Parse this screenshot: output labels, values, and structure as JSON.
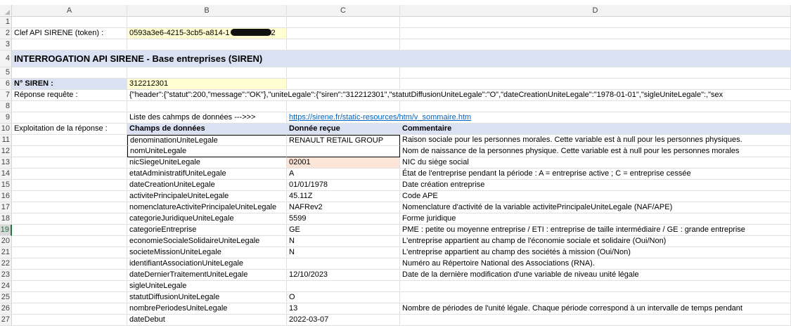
{
  "columns": [
    "A",
    "B",
    "C",
    "D"
  ],
  "rows": [
    {
      "n": "1"
    },
    {
      "n": "2",
      "a": "Clef API SIRENE (token) :",
      "b": "0593a3e6-4215-3cb5-a814-1",
      "b_tail": "2"
    },
    {
      "n": "3"
    },
    {
      "n": "4",
      "a": "INTERROGATION API SIRENE - Base entreprises (SIREN)"
    },
    {
      "n": "5"
    },
    {
      "n": "6",
      "a": "N° SIREN :",
      "b": "312212301"
    },
    {
      "n": "7",
      "a": "Réponse requête :",
      "b": "{\"header\":{\"statut\":200,\"message\":\"OK\"},\"uniteLegale\":{\"siren\":\"312212301\",\"statutDiffusionUniteLegale\":\"O\",\"dateCreationUniteLegale\":\"1978-01-01\",\"sigleUniteLegale\":,\"sex"
    },
    {
      "n": "8"
    },
    {
      "n": "9",
      "b": "Liste des cahmps de données --->>>",
      "c": "https://sirene.fr/static-resources/htm/v_sommaire.htm"
    },
    {
      "n": "10",
      "a": "Exploitation de la réponse :",
      "b": "Champs de données",
      "c": "Donnée reçue",
      "d": "Commentaire"
    },
    {
      "n": "11",
      "b": "denominationUniteLegale",
      "c": "RENAULT RETAIL GROUP",
      "d": "Raison sociale pour les personnes morales. Cette variable est à null pour les personnes physiques."
    },
    {
      "n": "12",
      "b": "nomUniteLegale",
      "c": "",
      "d": "Nom de naissance de la personnes physique. Cette variable est à null pour les personnes morales"
    },
    {
      "n": "13",
      "b": "nicSiegeUniteLegale",
      "c": "02001",
      "d": "NIC du siège social"
    },
    {
      "n": "14",
      "b": "etatAdministratifUniteLegale",
      "c": "A",
      "d": "État de l'entreprise pendant la période : A = entreprise active ; C = entreprise cessée"
    },
    {
      "n": "15",
      "b": "dateCreationUniteLegale",
      "c": "01/01/1978",
      "d": "Date création entreprise"
    },
    {
      "n": "16",
      "b": "activitePrincipaleUniteLegale",
      "c": "45.11Z",
      "d": "Code APE"
    },
    {
      "n": "17",
      "b": "nomenclatureActivitePrincipaleUniteLegale",
      "c": "NAFRev2",
      "d": "Nomenclature d'activité de la variable activitePrincipaleUniteLegale (NAF/APE)"
    },
    {
      "n": "18",
      "b": "categorieJuridiqueUniteLegale",
      "c": "5599",
      "d": "Forme juridique"
    },
    {
      "n": "19",
      "b": "categorieEntreprise",
      "c": "GE",
      "d": "PME : petite ou moyenne entreprise / ETI : entreprise de taille intermédiaire / GE : grande entreprise"
    },
    {
      "n": "20",
      "b": "economieSocialeSolidaireUniteLegale",
      "c": "N",
      "d": "L'entreprise appartient au champ de l'économie sociale et solidaire (Oui/Non)"
    },
    {
      "n": "21",
      "b": "societeMissionUniteLegale",
      "c": "N",
      "d": "L'entreprise appartient au champ des sociétés à mission (Oui/Non)"
    },
    {
      "n": "22",
      "b": "identifiantAssociationUniteLegale",
      "c": "",
      "d": "Numéro au Répertoire National des Associations (RNA)."
    },
    {
      "n": "23",
      "b": "dateDernierTraitementUniteLegale",
      "c": "12/10/2023",
      "d": "Date de la dernière modification d'une variable de niveau unité légale"
    },
    {
      "n": "24",
      "b": "sigleUniteLegale",
      "c": "",
      "d": ""
    },
    {
      "n": "25",
      "b": "statutDiffusionUniteLegale",
      "c": "O",
      "d": ""
    },
    {
      "n": "26",
      "b": "nombrePeriodesUniteLegale",
      "c": "13",
      "d": "Nombre de périodes de l'unité légale. Chaque période correspond à un intervalle de temps pendant"
    },
    {
      "n": "27",
      "b": "dateDebut",
      "c": "2022-03-07",
      "d": ""
    }
  ],
  "colors": {
    "yellow": "#fffdd1",
    "band": "#d9e1f2",
    "salmon": "#fce4d6",
    "link": "#0563c1",
    "accent": "#217346"
  }
}
